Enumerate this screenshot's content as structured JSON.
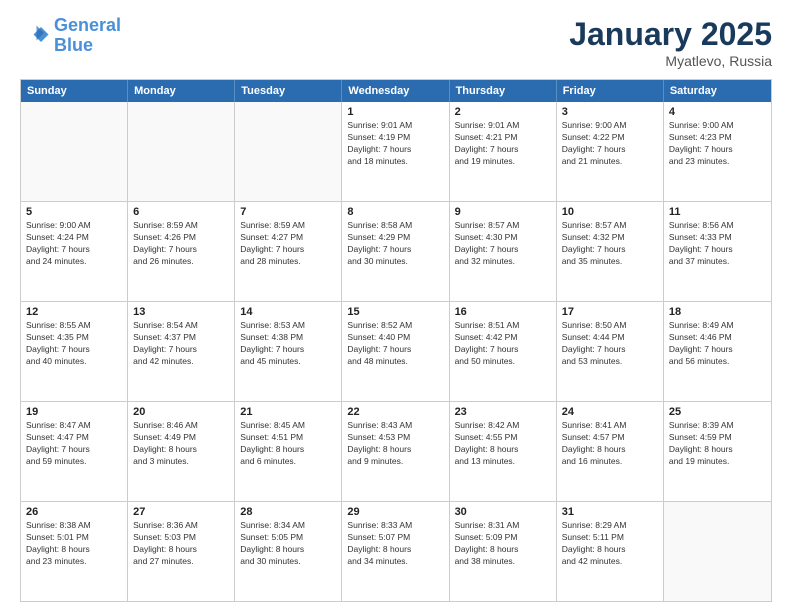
{
  "logo": {
    "line1": "General",
    "line2": "Blue"
  },
  "title": "January 2025",
  "subtitle": "Myatlevo, Russia",
  "header_days": [
    "Sunday",
    "Monday",
    "Tuesday",
    "Wednesday",
    "Thursday",
    "Friday",
    "Saturday"
  ],
  "weeks": [
    [
      {
        "day": "",
        "info": ""
      },
      {
        "day": "",
        "info": ""
      },
      {
        "day": "",
        "info": ""
      },
      {
        "day": "1",
        "info": "Sunrise: 9:01 AM\nSunset: 4:19 PM\nDaylight: 7 hours\nand 18 minutes."
      },
      {
        "day": "2",
        "info": "Sunrise: 9:01 AM\nSunset: 4:21 PM\nDaylight: 7 hours\nand 19 minutes."
      },
      {
        "day": "3",
        "info": "Sunrise: 9:00 AM\nSunset: 4:22 PM\nDaylight: 7 hours\nand 21 minutes."
      },
      {
        "day": "4",
        "info": "Sunrise: 9:00 AM\nSunset: 4:23 PM\nDaylight: 7 hours\nand 23 minutes."
      }
    ],
    [
      {
        "day": "5",
        "info": "Sunrise: 9:00 AM\nSunset: 4:24 PM\nDaylight: 7 hours\nand 24 minutes."
      },
      {
        "day": "6",
        "info": "Sunrise: 8:59 AM\nSunset: 4:26 PM\nDaylight: 7 hours\nand 26 minutes."
      },
      {
        "day": "7",
        "info": "Sunrise: 8:59 AM\nSunset: 4:27 PM\nDaylight: 7 hours\nand 28 minutes."
      },
      {
        "day": "8",
        "info": "Sunrise: 8:58 AM\nSunset: 4:29 PM\nDaylight: 7 hours\nand 30 minutes."
      },
      {
        "day": "9",
        "info": "Sunrise: 8:57 AM\nSunset: 4:30 PM\nDaylight: 7 hours\nand 32 minutes."
      },
      {
        "day": "10",
        "info": "Sunrise: 8:57 AM\nSunset: 4:32 PM\nDaylight: 7 hours\nand 35 minutes."
      },
      {
        "day": "11",
        "info": "Sunrise: 8:56 AM\nSunset: 4:33 PM\nDaylight: 7 hours\nand 37 minutes."
      }
    ],
    [
      {
        "day": "12",
        "info": "Sunrise: 8:55 AM\nSunset: 4:35 PM\nDaylight: 7 hours\nand 40 minutes."
      },
      {
        "day": "13",
        "info": "Sunrise: 8:54 AM\nSunset: 4:37 PM\nDaylight: 7 hours\nand 42 minutes."
      },
      {
        "day": "14",
        "info": "Sunrise: 8:53 AM\nSunset: 4:38 PM\nDaylight: 7 hours\nand 45 minutes."
      },
      {
        "day": "15",
        "info": "Sunrise: 8:52 AM\nSunset: 4:40 PM\nDaylight: 7 hours\nand 48 minutes."
      },
      {
        "day": "16",
        "info": "Sunrise: 8:51 AM\nSunset: 4:42 PM\nDaylight: 7 hours\nand 50 minutes."
      },
      {
        "day": "17",
        "info": "Sunrise: 8:50 AM\nSunset: 4:44 PM\nDaylight: 7 hours\nand 53 minutes."
      },
      {
        "day": "18",
        "info": "Sunrise: 8:49 AM\nSunset: 4:46 PM\nDaylight: 7 hours\nand 56 minutes."
      }
    ],
    [
      {
        "day": "19",
        "info": "Sunrise: 8:47 AM\nSunset: 4:47 PM\nDaylight: 7 hours\nand 59 minutes."
      },
      {
        "day": "20",
        "info": "Sunrise: 8:46 AM\nSunset: 4:49 PM\nDaylight: 8 hours\nand 3 minutes."
      },
      {
        "day": "21",
        "info": "Sunrise: 8:45 AM\nSunset: 4:51 PM\nDaylight: 8 hours\nand 6 minutes."
      },
      {
        "day": "22",
        "info": "Sunrise: 8:43 AM\nSunset: 4:53 PM\nDaylight: 8 hours\nand 9 minutes."
      },
      {
        "day": "23",
        "info": "Sunrise: 8:42 AM\nSunset: 4:55 PM\nDaylight: 8 hours\nand 13 minutes."
      },
      {
        "day": "24",
        "info": "Sunrise: 8:41 AM\nSunset: 4:57 PM\nDaylight: 8 hours\nand 16 minutes."
      },
      {
        "day": "25",
        "info": "Sunrise: 8:39 AM\nSunset: 4:59 PM\nDaylight: 8 hours\nand 19 minutes."
      }
    ],
    [
      {
        "day": "26",
        "info": "Sunrise: 8:38 AM\nSunset: 5:01 PM\nDaylight: 8 hours\nand 23 minutes."
      },
      {
        "day": "27",
        "info": "Sunrise: 8:36 AM\nSunset: 5:03 PM\nDaylight: 8 hours\nand 27 minutes."
      },
      {
        "day": "28",
        "info": "Sunrise: 8:34 AM\nSunset: 5:05 PM\nDaylight: 8 hours\nand 30 minutes."
      },
      {
        "day": "29",
        "info": "Sunrise: 8:33 AM\nSunset: 5:07 PM\nDaylight: 8 hours\nand 34 minutes."
      },
      {
        "day": "30",
        "info": "Sunrise: 8:31 AM\nSunset: 5:09 PM\nDaylight: 8 hours\nand 38 minutes."
      },
      {
        "day": "31",
        "info": "Sunrise: 8:29 AM\nSunset: 5:11 PM\nDaylight: 8 hours\nand 42 minutes."
      },
      {
        "day": "",
        "info": ""
      }
    ]
  ]
}
